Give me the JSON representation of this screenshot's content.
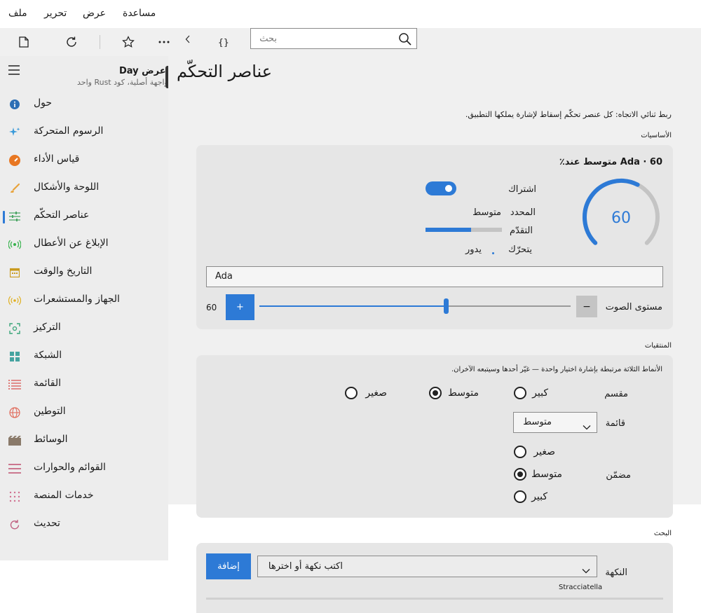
{
  "menubar": {
    "file": "ملف",
    "edit": "تحرير",
    "view": "عرض",
    "help": "مساعدة"
  },
  "toolbar": {
    "search_placeholder": "بحث"
  },
  "sidebar": {
    "app_title": "عرض Day",
    "app_subtitle": "واجهة أصلية، كود Rust واحد",
    "items": [
      {
        "label": "حول",
        "icon": "info-icon",
        "color": "#2d6fb5"
      },
      {
        "label": "الرسوم المتحركة",
        "icon": "sparkle-icon",
        "color": "#3a9ad9"
      },
      {
        "label": "قياس الأداء",
        "icon": "speedometer-icon",
        "color": "#e87722"
      },
      {
        "label": "اللوحة والأشكال",
        "icon": "brush-icon",
        "color": "#e8a33b"
      },
      {
        "label": "عناصر التحكّم",
        "icon": "sliders-icon",
        "color": "#4aa564",
        "active": true
      },
      {
        "label": "الإبلاغ عن الأعطال",
        "icon": "broadcast-icon",
        "color": "#37b24d"
      },
      {
        "label": "التاريخ والوقت",
        "icon": "calendar-icon",
        "color": "#c99a1e"
      },
      {
        "label": "الجهاز والمستشعرات",
        "icon": "sensor-icon",
        "color": "#e0b020"
      },
      {
        "label": "التركيز",
        "icon": "focus-icon",
        "color": "#3aa57a"
      },
      {
        "label": "الشبكة",
        "icon": "grid-icon",
        "color": "#45a3a0"
      },
      {
        "label": "القائمة",
        "icon": "list-icon",
        "color": "#d9534f"
      },
      {
        "label": "التوطين",
        "icon": "globe-icon",
        "color": "#e06a5a"
      },
      {
        "label": "الوسائط",
        "icon": "media-icon",
        "color": "#8a7a6a"
      },
      {
        "label": "القوائم والحوارات",
        "icon": "menu-icon",
        "color": "#c05070"
      },
      {
        "label": "خدمات المنصة",
        "icon": "dots-grid-icon",
        "color": "#d07090"
      },
      {
        "label": "تحديث",
        "icon": "refresh-icon",
        "color": "#c06080"
      }
    ]
  },
  "main": {
    "title": "عناصر التحكّم",
    "description": "ربط ثنائي الاتجاه: كل عنصر تحكّم إسقاط لإشارة يملكها التطبيق.",
    "basics": {
      "heading": "الأساسيات",
      "card_title": "Ada · 60 متوسط عند٪",
      "subscribe_label": "اشتراك",
      "subscribe_on": true,
      "selected_label": "المحدد",
      "selected_value": "متوسط",
      "progress_label": "التقدّم",
      "progress_fraction": 0.6,
      "moving_label": "يتحرّك",
      "moving_value": "يدور",
      "gauge_value": "60",
      "gauge_fraction": 0.6,
      "name_value": "Ada",
      "volume_label": "مستوى الصوت",
      "volume_minus": "−",
      "volume_plus": "+",
      "volume_value": "60",
      "volume_fraction": 0.6
    },
    "pickers": {
      "heading": "المنتقيات",
      "note": "الأنماط الثلاثة مرتبطة بإشارة اختيار واحدة — غيّر أحدها وسيتبعه الآخران.",
      "segmented_label": "مقسم",
      "options": [
        "كبير",
        "متوسط",
        "صغير"
      ],
      "selected": "متوسط",
      "list_label": "قائمة",
      "dropdown_value": "متوسط",
      "inline_label": "مضمّن",
      "inline_options": [
        "صغير",
        "متوسط",
        "كبير"
      ]
    },
    "search": {
      "heading": "البحث",
      "flavor_label": "النكهة",
      "combo_placeholder": "اكتب نكهة أو اخترها",
      "add_button": "إضافة",
      "chip": "Stracciatella"
    }
  }
}
